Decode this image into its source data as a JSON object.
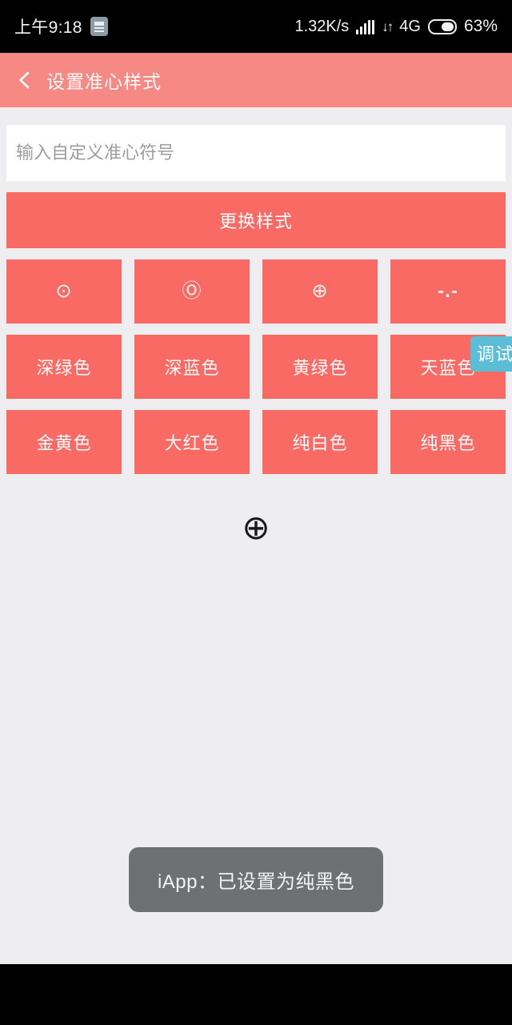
{
  "status_bar": {
    "clock": "上午9:18",
    "note_icon": "note-icon",
    "net_speed": "1.32K/s",
    "signal_icon": "signal-bars-icon",
    "data_transfer_icon": "data-updown-icon",
    "data_transfer_glyph": "↓↑",
    "network_type": "4G",
    "battery_icon": "battery-icon",
    "battery_percent": "63%"
  },
  "title_bar": {
    "back_icon": "back-chevron-icon",
    "title": "设置准心样式",
    "bg_color": "#f68984"
  },
  "form": {
    "input_placeholder": "输入自定义准心符号",
    "input_value": "",
    "change_style_label": "更换样式"
  },
  "symbol_row": {
    "items": [
      {
        "label": "⊙",
        "name": "symbol-circled-dot"
      },
      {
        "label": "Ⓞ",
        "name": "symbol-circled-o"
      },
      {
        "label": "⊕",
        "name": "symbol-circled-plus"
      },
      {
        "label": "-.-",
        "name": "symbol-dash-dot-dash"
      }
    ]
  },
  "color_rows": [
    {
      "items": [
        {
          "label": "深绿色",
          "name": "color-dark-green"
        },
        {
          "label": "深蓝色",
          "name": "color-dark-blue"
        },
        {
          "label": "黄绿色",
          "name": "color-yellow-green"
        },
        {
          "label": "天蓝色",
          "name": "color-sky-blue"
        }
      ]
    },
    {
      "items": [
        {
          "label": "金黄色",
          "name": "color-golden-yellow"
        },
        {
          "label": "大红色",
          "name": "color-bright-red"
        },
        {
          "label": "纯白色",
          "name": "color-pure-white"
        },
        {
          "label": "纯黑色",
          "name": "color-pure-black"
        }
      ]
    }
  ],
  "debug_badge": {
    "label": "调试",
    "bg_color": "#5bbdd6"
  },
  "crosshair_preview": {
    "glyph": "⊕",
    "icon_name": "crosshair-circled-plus-icon"
  },
  "toast": {
    "message": "iApp：已设置为纯黑色",
    "bg_color": "#6f7072"
  },
  "theme": {
    "button_color": "#fa6a64",
    "header_color": "#f68984",
    "page_background": "#eeeef1",
    "nav_bar_color": "#000000"
  }
}
